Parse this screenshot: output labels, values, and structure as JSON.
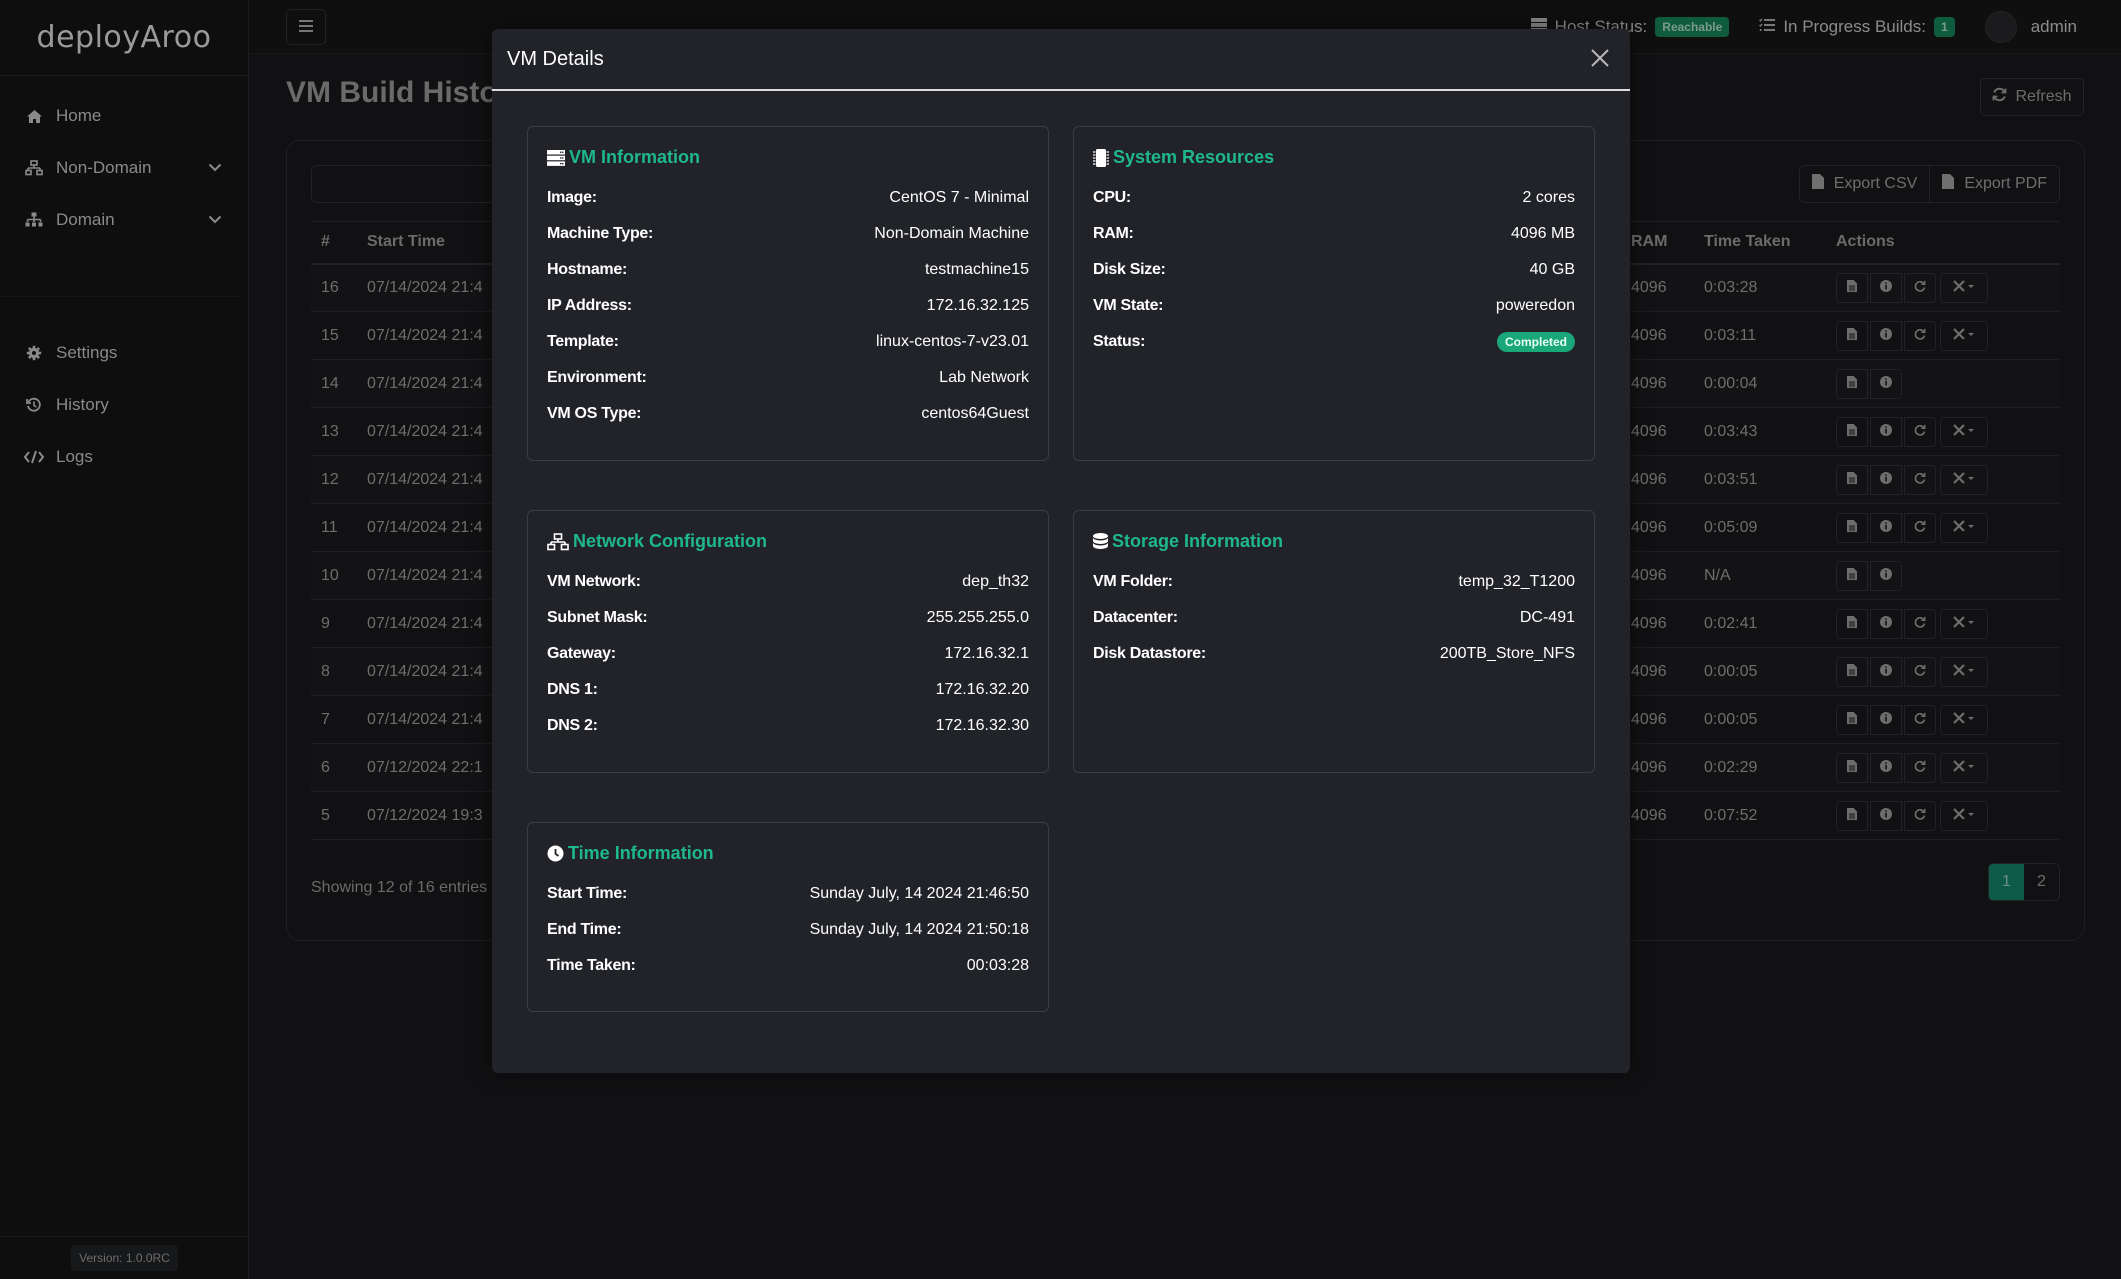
{
  "app": {
    "logo_text": "deployAroo",
    "version": "Version: 1.0.0RC"
  },
  "sidebar": {
    "items": [
      {
        "label": "Home",
        "icon": "home-icon"
      },
      {
        "label": "Non-Domain",
        "icon": "network-icon",
        "expandable": true
      },
      {
        "label": "Domain",
        "icon": "sitemap-icon",
        "expandable": true
      },
      {
        "label": "Settings",
        "icon": "gear-icon"
      },
      {
        "label": "History",
        "icon": "history-icon"
      },
      {
        "label": "Logs",
        "icon": "code-icon"
      }
    ]
  },
  "topbar": {
    "host_status_label": "Host Status:",
    "host_status_value": "Reachable",
    "in_progress_label": "In Progress Builds:",
    "in_progress_count": "1",
    "user_name": "admin"
  },
  "page": {
    "title": "VM Build History",
    "refresh_label": "Refresh",
    "export_csv_label": "Export CSV",
    "export_pdf_label": "Export PDF",
    "table": {
      "columns_visible": [
        "#",
        "Start Time",
        "RAM",
        "Time Taken",
        "Actions"
      ],
      "rows": [
        {
          "id": "16",
          "start": "07/14/2024 21:4",
          "ram": "4096",
          "time": "0:03:28",
          "full_actions": true
        },
        {
          "id": "15",
          "start": "07/14/2024 21:4",
          "ram": "4096",
          "time": "0:03:11",
          "full_actions": true
        },
        {
          "id": "14",
          "start": "07/14/2024 21:4",
          "ram": "4096",
          "time": "0:00:04",
          "full_actions": false
        },
        {
          "id": "13",
          "start": "07/14/2024 21:4",
          "ram": "4096",
          "time": "0:03:43",
          "full_actions": true
        },
        {
          "id": "12",
          "start": "07/14/2024 21:4",
          "ram": "4096",
          "time": "0:03:51",
          "full_actions": true
        },
        {
          "id": "11",
          "start": "07/14/2024 21:4",
          "ram": "4096",
          "time": "0:05:09",
          "full_actions": true
        },
        {
          "id": "10",
          "start": "07/14/2024 21:4",
          "ram": "4096",
          "time": "N/A",
          "full_actions": false
        },
        {
          "id": "9",
          "start": "07/14/2024 21:4",
          "ram": "4096",
          "time": "0:02:41",
          "full_actions": true
        },
        {
          "id": "8",
          "start": "07/14/2024 21:4",
          "ram": "4096",
          "time": "0:00:05",
          "full_actions": true
        },
        {
          "id": "7",
          "start": "07/14/2024 21:4",
          "ram": "4096",
          "time": "0:00:05",
          "full_actions": true
        },
        {
          "id": "6",
          "start": "07/12/2024 22:1",
          "ram": "4096",
          "time": "0:02:29",
          "full_actions": true
        },
        {
          "id": "5",
          "start": "07/12/2024 19:3",
          "ram": "4096",
          "time": "0:07:52",
          "full_actions": true
        }
      ]
    },
    "showing_text": "Showing 12 of 16 entries",
    "pagination": {
      "pages": [
        "1",
        "2"
      ],
      "active": "1"
    }
  },
  "modal": {
    "title": "VM Details",
    "close_icon": "close-icon",
    "vm_info": {
      "title": "VM Information",
      "icon": "server-icon",
      "rows": [
        {
          "k": "Image:",
          "v": "CentOS 7 - Minimal"
        },
        {
          "k": "Machine Type:",
          "v": "Non-Domain Machine"
        },
        {
          "k": "Hostname:",
          "v": "testmachine15"
        },
        {
          "k": "IP Address:",
          "v": "172.16.32.125"
        },
        {
          "k": "Template:",
          "v": "linux-centos-7-v23.01"
        },
        {
          "k": "Environment:",
          "v": "Lab Network"
        },
        {
          "k": "VM OS Type:",
          "v": "centos64Guest"
        }
      ]
    },
    "system": {
      "title": "System Resources",
      "icon": "chip-icon",
      "rows": [
        {
          "k": "CPU:",
          "v": "2 cores"
        },
        {
          "k": "RAM:",
          "v": "4096 MB"
        },
        {
          "k": "Disk Size:",
          "v": "40 GB"
        },
        {
          "k": "VM State:",
          "v": "poweredon"
        }
      ],
      "status_label": "Status:",
      "status_value": "Completed"
    },
    "network": {
      "title": "Network Configuration",
      "icon": "network-icon",
      "rows": [
        {
          "k": "VM Network:",
          "v": "dep_th32"
        },
        {
          "k": "Subnet Mask:",
          "v": "255.255.255.0"
        },
        {
          "k": "Gateway:",
          "v": "172.16.32.1"
        },
        {
          "k": "DNS 1:",
          "v": "172.16.32.20"
        },
        {
          "k": "DNS 2:",
          "v": "172.16.32.30"
        }
      ]
    },
    "storage": {
      "title": "Storage Information",
      "icon": "database-icon",
      "rows": [
        {
          "k": "VM Folder:",
          "v": "temp_32_T1200"
        },
        {
          "k": "Datacenter:",
          "v": "DC-491"
        },
        {
          "k": "Disk Datastore:",
          "v": "200TB_Store_NFS"
        }
      ]
    },
    "time": {
      "title": "Time Information",
      "icon": "clock-icon",
      "rows": [
        {
          "k": "Start Time:",
          "v": "Sunday July, 14 2024 21:46:50"
        },
        {
          "k": "End Time:",
          "v": "Sunday July, 14 2024 21:50:18"
        },
        {
          "k": "Time Taken:",
          "v": "00:03:28"
        }
      ]
    }
  },
  "colors": {
    "accent": "#1fb88b",
    "status_completed": "#1aa779",
    "badge_green": "#0f5b3d",
    "modal_bg": "#212328"
  }
}
